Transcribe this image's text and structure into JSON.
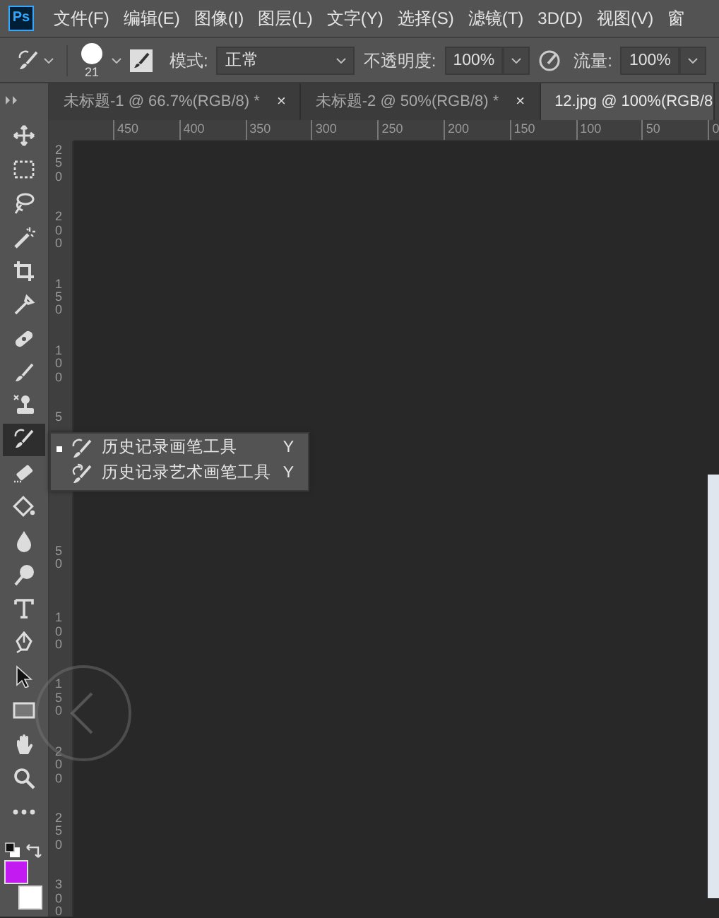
{
  "app": {
    "logo": "Ps"
  },
  "menu_bar": [
    "文件(F)",
    "编辑(E)",
    "图像(I)",
    "图层(L)",
    "文字(Y)",
    "选择(S)",
    "滤镜(T)",
    "3D(D)",
    "视图(V)",
    "窗"
  ],
  "options_bar": {
    "brush_size": "21",
    "mode_label": "模式:",
    "mode_value": "正常",
    "opacity_label": "不透明度:",
    "opacity_value": "100%",
    "flow_label": "流量:",
    "flow_value": "100%"
  },
  "tabs": [
    {
      "label": "未标题-1 @ 66.7%(RGB/8) *",
      "close": "×",
      "selected": false
    },
    {
      "label": "未标题-2 @ 50%(RGB/8) *",
      "close": "×",
      "selected": false
    },
    {
      "label": "12.jpg @ 100%(RGB/8",
      "selected": true
    }
  ],
  "horizontal_ruler": [
    "450",
    "400",
    "350",
    "300",
    "250",
    "200",
    "150",
    "100",
    "50",
    "0"
  ],
  "vertical_ruler": [
    "250",
    "200",
    "150",
    "100",
    "5",
    "50",
    "100",
    "150",
    "200",
    "250",
    "300"
  ],
  "tools": [
    {
      "kind": "move",
      "selected": false
    },
    {
      "kind": "marquee",
      "selected": false
    },
    {
      "kind": "lasso",
      "selected": false
    },
    {
      "kind": "wand",
      "selected": false
    },
    {
      "kind": "crop",
      "selected": false
    },
    {
      "kind": "eyedropper",
      "selected": false
    },
    {
      "kind": "heal",
      "selected": false
    },
    {
      "kind": "brush",
      "selected": false
    },
    {
      "kind": "stamp",
      "selected": false
    },
    {
      "kind": "history",
      "selected": true
    },
    {
      "kind": "eraser",
      "selected": false
    },
    {
      "kind": "bucket",
      "selected": false
    },
    {
      "kind": "blur",
      "selected": false
    },
    {
      "kind": "dodge",
      "selected": false
    },
    {
      "kind": "type",
      "selected": false
    },
    {
      "kind": "pen",
      "selected": false
    },
    {
      "kind": "select",
      "selected": false
    },
    {
      "kind": "shape",
      "selected": false
    },
    {
      "kind": "hand",
      "selected": false
    },
    {
      "kind": "zoom",
      "selected": false
    },
    {
      "kind": "more",
      "selected": false
    }
  ],
  "color_swatches": [
    {
      "kind": "background",
      "color": "#ffffff"
    },
    {
      "kind": "foreground",
      "color": "#c21af0"
    }
  ],
  "flyout": [
    {
      "kind": "history",
      "label": "历史记录画笔工具",
      "shortcut": "Y",
      "selected": true
    },
    {
      "kind": "art",
      "label": "历史记录艺术画笔工具",
      "shortcut": "Y",
      "selected": false
    }
  ]
}
